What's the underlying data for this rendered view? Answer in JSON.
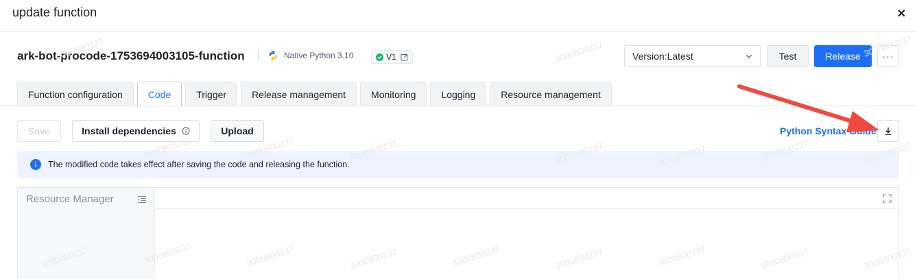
{
  "dialog": {
    "title": "update function",
    "close_icon": "close-icon"
  },
  "header": {
    "function_name": "ark-bot-procode-1753694003105-function",
    "runtime": "Native Python 3.10",
    "version_badge": "V1",
    "version_select": "Version:Latest",
    "test_label": "Test",
    "release_label": "Release",
    "more_label": "···"
  },
  "tabs": [
    {
      "label": "Function configuration",
      "active": false
    },
    {
      "label": "Code",
      "active": true
    },
    {
      "label": "Trigger",
      "active": false
    },
    {
      "label": "Release management",
      "active": false
    },
    {
      "label": "Monitoring",
      "active": false
    },
    {
      "label": "Logging",
      "active": false
    },
    {
      "label": "Resource management",
      "active": false
    }
  ],
  "toolbar": {
    "save_label": "Save",
    "install_label": "Install dependencies",
    "upload_label": "Upload",
    "syntax_link": "Python Syntax Guide",
    "download_icon": "download-icon"
  },
  "notice": {
    "text": "The modified code takes effect after saving the code and releasing the function."
  },
  "editor": {
    "resource_manager_title": "Resource Manager"
  },
  "watermark": "3000800237",
  "colors": {
    "accent": "#1e6ff7",
    "arrow": "#f04a3e",
    "notice_bg": "#eef4ff",
    "success": "#23b26d"
  }
}
